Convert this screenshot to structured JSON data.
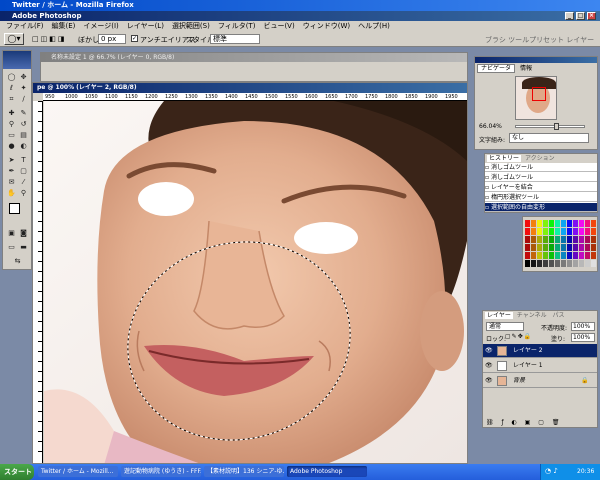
{
  "firefox_title": "Twitter / ホーム - Mozilla Firefox",
  "app": {
    "title": "Adobe Photoshop",
    "menu": [
      "ファイル(F)",
      "編集(E)",
      "イメージ(I)",
      "レイヤー(L)",
      "選択範囲(S)",
      "フィルタ(T)",
      "ビュー(V)",
      "ウィンドウ(W)",
      "ヘルプ(H)"
    ]
  },
  "options_bar": {
    "feather_label": "ぼかし:",
    "feather_value": "0 px",
    "antialias_label": "アンチエイリアス",
    "style_label": "スタイル:",
    "style_value": "標準",
    "palette_tabs": "ブラシ ツールプリセット レイヤーカンプ"
  },
  "doc_back": {
    "title": "名称未設定 1 @ 66.7% (レイヤー 0, RGB/8)"
  },
  "doc_main": {
    "title": "pe @ 100% (レイヤー 2, RGB/8)"
  },
  "rulers": [
    "950",
    "1000",
    "1050",
    "1100",
    "1150",
    "1200",
    "1250",
    "1300",
    "1350",
    "1400",
    "1450",
    "1500",
    "1550",
    "1600",
    "1650",
    "1700",
    "1750",
    "1800",
    "1850",
    "1900",
    "1950"
  ],
  "navigator": {
    "tabs": [
      "ナビゲータ",
      "情報"
    ],
    "zoom": "66.04%",
    "char_label": "文字組み:",
    "char_value": "なし"
  },
  "history": {
    "tabs": [
      "ヒストリー",
      "アクション"
    ],
    "items": [
      "消しゴムツール",
      "消しゴムツール",
      "レイヤーを結合",
      "楕円形選択ツール",
      "選択範囲の自由変形"
    ],
    "active_index": 4
  },
  "layers": {
    "tabs": [
      "レイヤー",
      "チャンネル",
      "パス"
    ],
    "blend_mode": "通常",
    "opacity_label": "不透明度:",
    "opacity_value": "100%",
    "lock_label": "ロック:",
    "fill_label": "塗り:",
    "fill_value": "100%",
    "items": [
      "レイヤー 2",
      "レイヤー 1",
      "背景"
    ],
    "active_index": 0
  },
  "taskbar": {
    "start": "スタート",
    "items": [
      "Twitter / ホーム - Mozill...",
      "遊記動物病院 (ゆうき) - FFF...",
      "【素材説明】136 シニア-ゆ...",
      "Adobe Photoshop"
    ],
    "active_index": 3,
    "clock": "20:36"
  },
  "colors": {
    "xp_blue": "#0a246a",
    "taskbar": "#245edb",
    "start_green": "#3c8f3c",
    "panel_gray": "#d4d0c8",
    "skin": "#e6b596"
  }
}
